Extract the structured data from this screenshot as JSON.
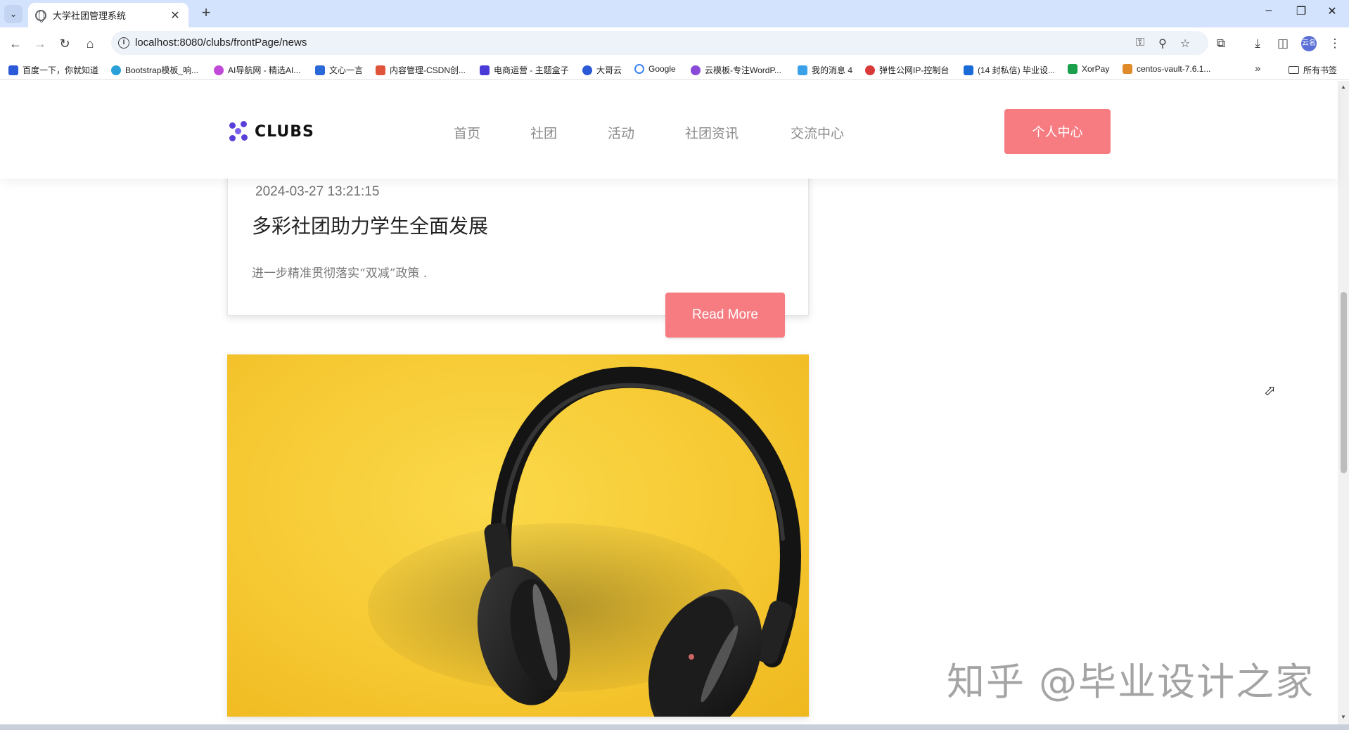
{
  "browser": {
    "tab_title": "大学社团管理系统",
    "url": "localhost:8080/clubs/frontPage/news",
    "bookmarks": [
      {
        "label": "百度一下，你就知道",
        "color": "#2a5ad8"
      },
      {
        "label": "Bootstrap模板_响...",
        "color": "#2aa0d8"
      },
      {
        "label": "AI导航网 - 精选AI...",
        "color": "#c24ad8"
      },
      {
        "label": "文心一言",
        "color": "#2a6ad8"
      },
      {
        "label": "内容管理-CSDN创...",
        "color": "#e0553a"
      },
      {
        "label": "电商运营 - 主题盒子",
        "color": "#4a3ad8"
      },
      {
        "label": "大哥云",
        "color": "#2a5ad8"
      },
      {
        "label": "Google",
        "color": "#4285f4"
      },
      {
        "label": "云模板-专注WordP...",
        "color": "#8a4ad8"
      },
      {
        "label": "我的消息 4",
        "color": "#3aa0e8"
      },
      {
        "label": "弹性公网IP-控制台",
        "color": "#d83a3a"
      },
      {
        "label": "(14 封私信) 毕业设...",
        "color": "#1a6ad8"
      },
      {
        "label": "XorPay",
        "color": "#1aa04a"
      },
      {
        "label": "centos-vault-7.6.1...",
        "color": "#e08a2a"
      }
    ],
    "bookmarks_folder": "所有书签",
    "profile_initials": "云名"
  },
  "header": {
    "logo_text": "CLUBS",
    "nav": [
      "首页",
      "社团",
      "活动",
      "社团资讯",
      "交流中心"
    ],
    "user_center": "个人中心"
  },
  "news": {
    "date": "2024-03-27 13:21:15",
    "title": "多彩社团助力学生全面发展",
    "excerpt": "进一步精准贯彻落实“双减”政策 .",
    "read_more": "Read More"
  },
  "watermark": "知乎 @毕业设计之家",
  "colors": {
    "accent": "#f67c82",
    "logo": "#5a3fd8",
    "image_bg": "#f6c933"
  }
}
